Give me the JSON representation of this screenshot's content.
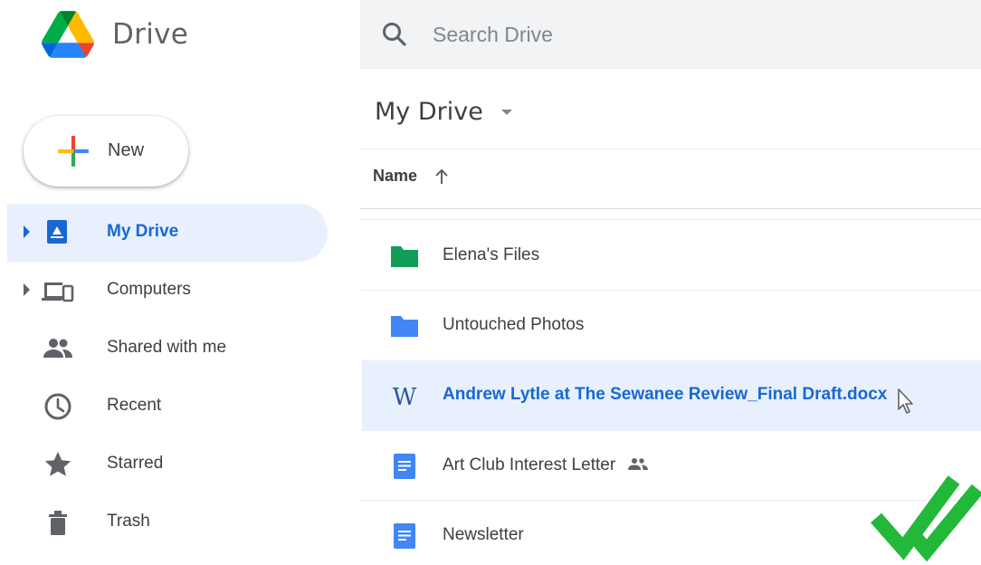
{
  "app": {
    "title": "Drive"
  },
  "search": {
    "placeholder": "Search Drive",
    "value": ""
  },
  "new_button": {
    "label": "New"
  },
  "sidebar": {
    "items": [
      {
        "label": "My Drive",
        "icon": "my-drive-icon",
        "active": true,
        "expandable": true
      },
      {
        "label": "Computers",
        "icon": "computers-icon",
        "active": false,
        "expandable": true
      },
      {
        "label": "Shared with me",
        "icon": "shared-icon",
        "active": false,
        "expandable": false
      },
      {
        "label": "Recent",
        "icon": "clock-icon",
        "active": false,
        "expandable": false
      },
      {
        "label": "Starred",
        "icon": "star-icon",
        "active": false,
        "expandable": false
      },
      {
        "label": "Trash",
        "icon": "trash-icon",
        "active": false,
        "expandable": false
      }
    ]
  },
  "main": {
    "title": "My Drive",
    "column_header": {
      "name": "Name",
      "sort": "ascending"
    },
    "files": [
      {
        "name": "Elena's Files",
        "icon": "folder-green-icon",
        "selected": false,
        "shared": false
      },
      {
        "name": "Untouched Photos",
        "icon": "folder-blue-icon",
        "selected": false,
        "shared": false
      },
      {
        "name": "Andrew Lytle at The Sewanee Review_Final Draft.docx",
        "icon": "word-doc-icon",
        "selected": true,
        "shared": false
      },
      {
        "name": "Art Club Interest Letter",
        "icon": "google-doc-icon",
        "selected": false,
        "shared": true
      },
      {
        "name": "Newsletter",
        "icon": "google-doc-icon",
        "selected": false,
        "shared": false
      }
    ]
  },
  "colors": {
    "accent": "#1967d2",
    "active_bg": "#e8f0fe",
    "folder_green": "#0f9d58",
    "folder_blue": "#4285f4",
    "check_green": "#22b83a"
  }
}
